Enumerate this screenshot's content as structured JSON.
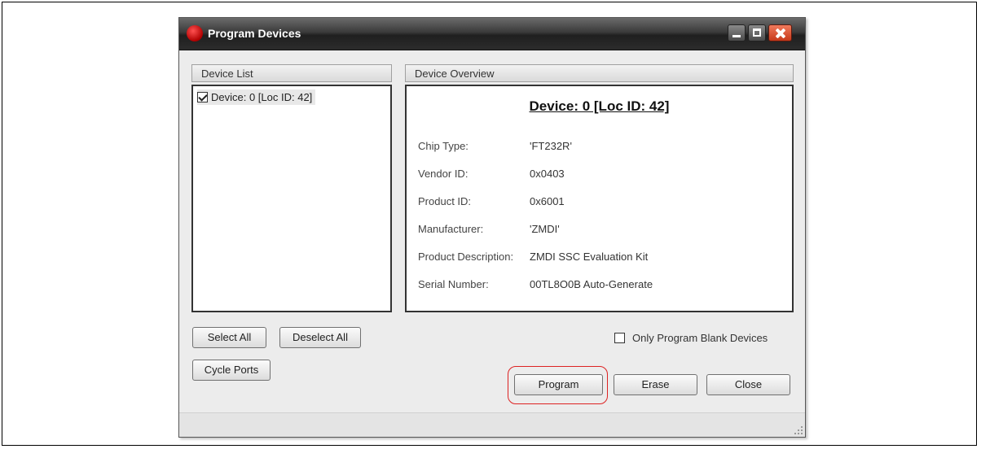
{
  "window": {
    "title": "Program Devices"
  },
  "device_list": {
    "header": "Device List",
    "items": [
      {
        "label": "Device: 0 [Loc ID: 42]",
        "checked": true
      }
    ]
  },
  "overview": {
    "header": "Device Overview",
    "title": "Device: 0 [Loc ID: 42]",
    "rows": [
      {
        "label": "Chip Type:",
        "value": "'FT232R'"
      },
      {
        "label": "Vendor ID:",
        "value": "0x0403"
      },
      {
        "label": "Product ID:",
        "value": "0x6001"
      },
      {
        "label": "Manufacturer:",
        "value": "'ZMDI'"
      },
      {
        "label": "Product Description:",
        "value": "ZMDI SSC Evaluation Kit"
      },
      {
        "label": "Serial Number:",
        "value": "00TL8O0B Auto-Generate"
      }
    ]
  },
  "buttons": {
    "select_all": "Select All",
    "deselect_all": "Deselect All",
    "cycle_ports": "Cycle Ports",
    "program": "Program",
    "erase": "Erase",
    "close": "Close"
  },
  "options": {
    "only_blank_label": "Only Program Blank Devices",
    "only_blank_checked": false
  },
  "colors": {
    "highlight": "#dd2222",
    "close_button": "#d9492a"
  }
}
